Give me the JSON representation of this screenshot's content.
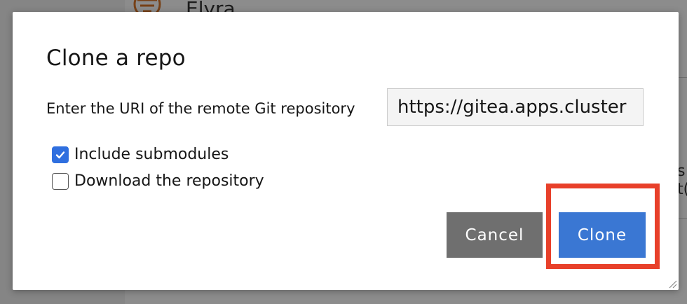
{
  "background": {
    "app_title": "Elyra",
    "right_edge_text_1": "s",
    "right_edge_text_2": "t("
  },
  "dialog": {
    "title": "Clone a repo",
    "uri_label": "Enter the URI of the remote Git repository",
    "uri_value": "https://gitea.apps.cluster",
    "options": {
      "include_submodules": {
        "label": "Include submodules",
        "checked": true
      },
      "download_repository": {
        "label": "Download the repository",
        "checked": false
      }
    },
    "buttons": {
      "cancel": "Cancel",
      "clone": "Clone"
    }
  },
  "colors": {
    "accent": "#3a77d3",
    "cancel": "#6f6f6f",
    "highlight": "#e8402a",
    "checkbox_checked": "#2f6fdf"
  }
}
